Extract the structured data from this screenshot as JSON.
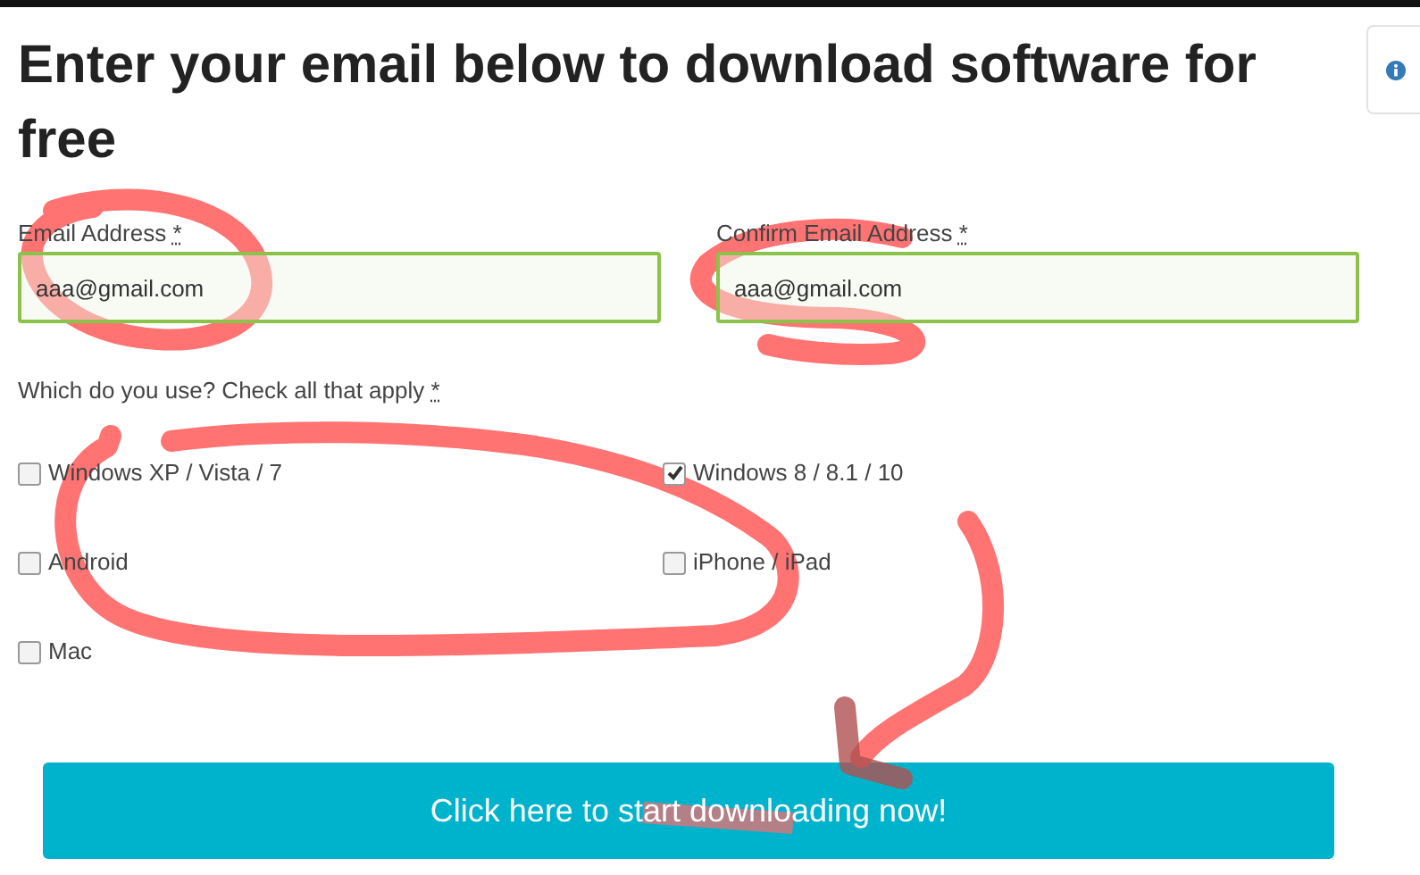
{
  "heading": "Enter your email below to download software for free",
  "fields": [
    {
      "label": "Email Address",
      "required_mark": "*",
      "value": "aaa@gmail.com"
    },
    {
      "label": "Confirm Email Address",
      "required_mark": "*",
      "value": "aaa@gmail.com"
    }
  ],
  "question": {
    "label": "Which do you use? Check all that apply",
    "required_mark": "*"
  },
  "options": [
    {
      "label": "Windows XP / Vista / 7",
      "checked": false
    },
    {
      "label": "Windows 8 / 8.1 / 10",
      "checked": true
    },
    {
      "label": "Android",
      "checked": false
    },
    {
      "label": "iPhone / iPad",
      "checked": false
    },
    {
      "label": "Mac",
      "checked": false
    }
  ],
  "button": {
    "label": "Click here to start downloading now!"
  }
}
